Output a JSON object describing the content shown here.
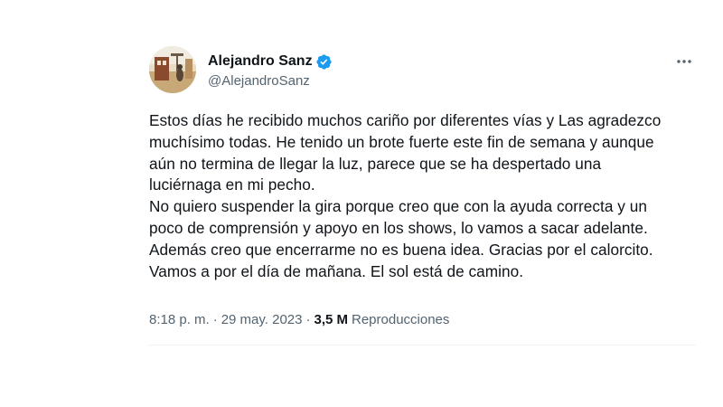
{
  "author": {
    "display_name": "Alejandro Sanz",
    "handle": "@AlejandroSanz",
    "verified": true,
    "avatar_icon": "profile-photo"
  },
  "tweet": {
    "text": "Estos días he recibido muchos cariño por diferentes vías y Las agradezco\nmuchísimo todas. He tenido un brote fuerte este fin de semana y aunque\naún no termina de llegar la luz, parece que se ha despertado una\nluciérnaga en mi pecho.\nNo quiero suspender la gira porque creo que con la ayuda correcta y un\npoco de comprensión y apoyo en los shows, lo vamos a sacar adelante.\nAdemás creo que encerrarme no es buena idea. Gracias por el calorcito.\nVamos a por el día de mañana. El sol está de camino.",
    "time": "8:18 p. m.",
    "date": "29 may. 2023",
    "views_count": "3,5 M",
    "views_label": "Reproducciones"
  },
  "icons": {
    "verified": "verified-badge-icon",
    "more": "more-options-icon"
  },
  "colors": {
    "text_primary": "#0f1419",
    "text_secondary": "#536471",
    "verified_blue": "#1d9bf0",
    "divider": "#eff3f4"
  }
}
